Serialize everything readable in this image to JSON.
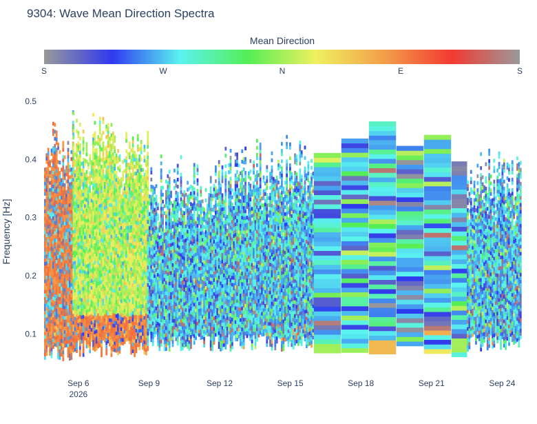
{
  "chart_data": {
    "type": "heatmap",
    "title": "9304: Wave Mean Direction Spectra",
    "colorbar": {
      "title": "Mean Direction",
      "tick_labels": [
        "S",
        "W",
        "N",
        "E",
        "S"
      ],
      "tick_values_deg": [
        180,
        270,
        0,
        90,
        180
      ],
      "colorscale": [
        "#999999",
        "#2f39ef",
        "#5af3f0",
        "#55ee55",
        "#f0f060",
        "#f29f4a",
        "#f33a32",
        "#999999"
      ]
    },
    "yaxis": {
      "label": "Frequency [Hz]",
      "range": [
        0.04,
        0.52
      ],
      "ticks": [
        0.1,
        0.2,
        0.3,
        0.4,
        0.5
      ]
    },
    "xaxis": {
      "tick_labels": [
        "Sep 6",
        "Sep 9",
        "Sep 12",
        "Sep 15",
        "Sep 18",
        "Sep 21",
        "Sep 24"
      ],
      "tick_sub_label": "2026",
      "tick_dates": [
        "2026-09-06",
        "2026-09-09",
        "2026-09-12",
        "2026-09-15",
        "2026-09-18",
        "2026-09-21",
        "2026-09-24"
      ],
      "range": [
        "2026-09-04T13:00",
        "2026-09-24T18:00"
      ]
    },
    "segments": [
      {
        "start": "2026-09-04T13:00",
        "end": "2026-09-05T18:00",
        "dominant_direction": "E (red)",
        "fmin": 0.05,
        "fmax": 0.48,
        "resolution": "high"
      },
      {
        "start": "2026-09-05T18:00",
        "end": "2026-09-08T22:00",
        "dominant_direction": "N (green/cyan)",
        "fmin": 0.06,
        "fmax": 0.48,
        "resolution": "high"
      },
      {
        "start": "2026-09-08T22:00",
        "end": "2026-09-16T00:00",
        "dominant_direction": "W (blue)",
        "fmin": 0.07,
        "fmax": 0.45,
        "resolution": "high"
      },
      {
        "start": "2026-09-16T00:00",
        "end": "2026-09-22T12:00",
        "dominant_direction": "W (blue)",
        "fmin": 0.06,
        "fmax": 0.47,
        "resolution": "coarse"
      },
      {
        "start": "2026-09-22T12:00",
        "end": "2026-09-24T18:00",
        "dominant_direction": "W (blue)",
        "fmin": 0.07,
        "fmax": 0.43,
        "resolution": "high"
      }
    ]
  }
}
